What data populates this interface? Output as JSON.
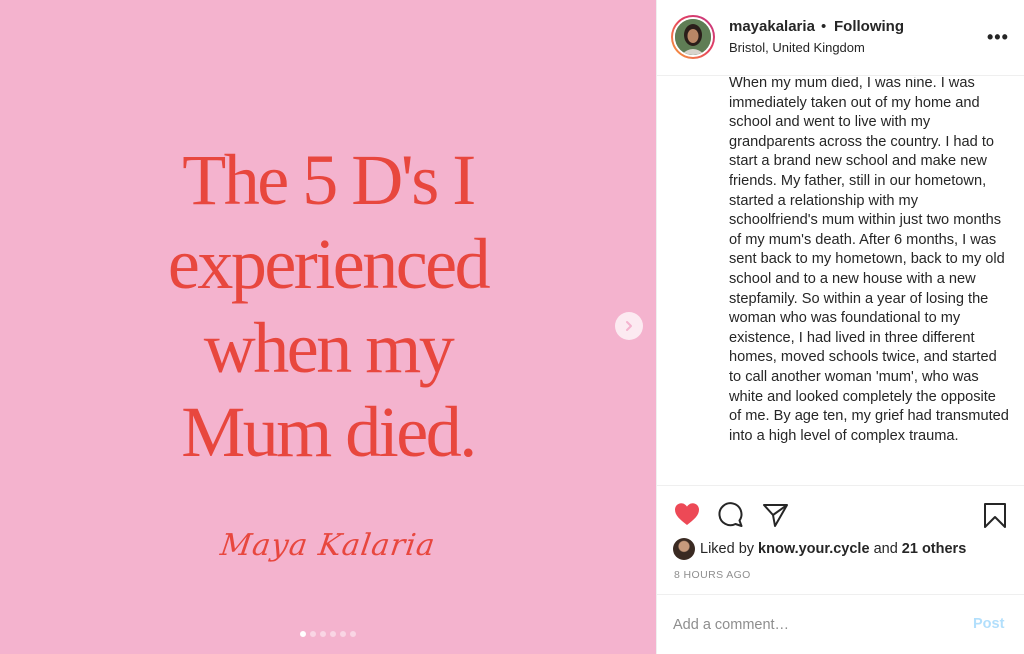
{
  "post_image": {
    "headline_lines": [
      "The 5 D's I",
      "experienced",
      "when my",
      "Mum died."
    ],
    "signature": "Maya Kalaria",
    "carousel": {
      "slide_count": 6,
      "active_index": 0
    },
    "background_color": "#f4b3ce",
    "text_color": "#e8473e",
    "next_icon": "chevron-right-icon"
  },
  "header": {
    "username": "mayakalaria",
    "separator": "•",
    "follow_status": "Following",
    "location": "Bristol, United Kingdom",
    "more_icon": "more-options-icon",
    "more_label": "•••"
  },
  "caption": {
    "text": "When my mum died, I was nine. I was immediately taken out of my home and school and went to live with my grandparents across the country. I had to start a brand new school and make new friends. My father, still in our hometown, started a relationship with my schoolfriend's mum within just two months of my mum's death. After 6 months, I was sent back to my hometown, back to my old school and to a new house with a new stepfamily. So within a year of losing the woman who was foundational to my existence, I had lived in three different homes, moved schools twice, and started to call another woman 'mum', who was white and looked completely the opposite of me. By age ten, my grief had transmuted into a high level of complex trauma."
  },
  "actions": {
    "like_icon": "heart-icon",
    "comment_icon": "comment-icon",
    "share_icon": "share-icon",
    "save_icon": "bookmark-icon",
    "liked": true,
    "like_color": "#ed4956"
  },
  "likes": {
    "prefix": "Liked by",
    "user": "know.your.cycle",
    "conjunction": "and",
    "others": "21 others"
  },
  "timestamp": "8 HOURS AGO",
  "comment": {
    "placeholder": "Add a comment…",
    "value": "",
    "post_label": "Post"
  }
}
